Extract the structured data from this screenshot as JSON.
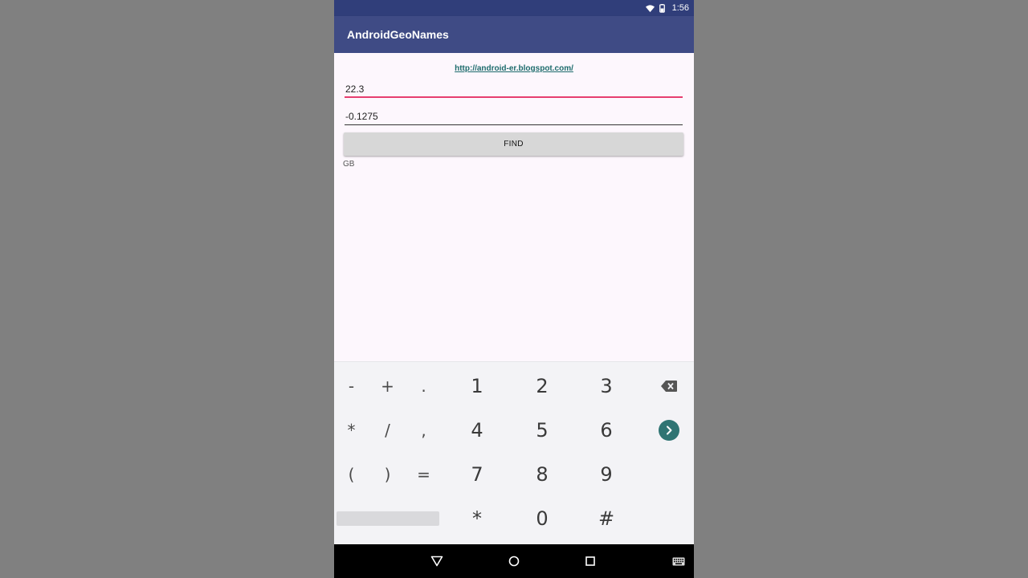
{
  "status_bar": {
    "time": "1:56",
    "icons": [
      "wifi-icon",
      "battery-icon"
    ]
  },
  "app_bar": {
    "title": "AndroidGeoNames"
  },
  "main": {
    "link_text": "http://android-er.blogspot.com/",
    "latitude_value": "22.3",
    "longitude_value": "-0.1275",
    "find_label": "FIND",
    "result_text": "GB"
  },
  "keyboard": {
    "row1": {
      "s1": "-",
      "s2": "+",
      "s3": ".",
      "n1": "1",
      "n2": "2",
      "n3": "3"
    },
    "row2": {
      "s1": "*",
      "s2": "/",
      "s3": ",",
      "n1": "4",
      "n2": "5",
      "n3": "6"
    },
    "row3": {
      "s1": "(",
      "s2": ")",
      "s3": "=",
      "n1": "7",
      "n2": "8",
      "n3": "9"
    },
    "row4": {
      "n1": "*",
      "n2": "0",
      "n3": "#"
    },
    "icons": [
      "backspace-icon",
      "next-icon"
    ],
    "accent_color": "#2f7473"
  },
  "nav_bar": {
    "icons": [
      "back-icon",
      "home-icon",
      "recents-icon",
      "keyboard-icon"
    ]
  }
}
